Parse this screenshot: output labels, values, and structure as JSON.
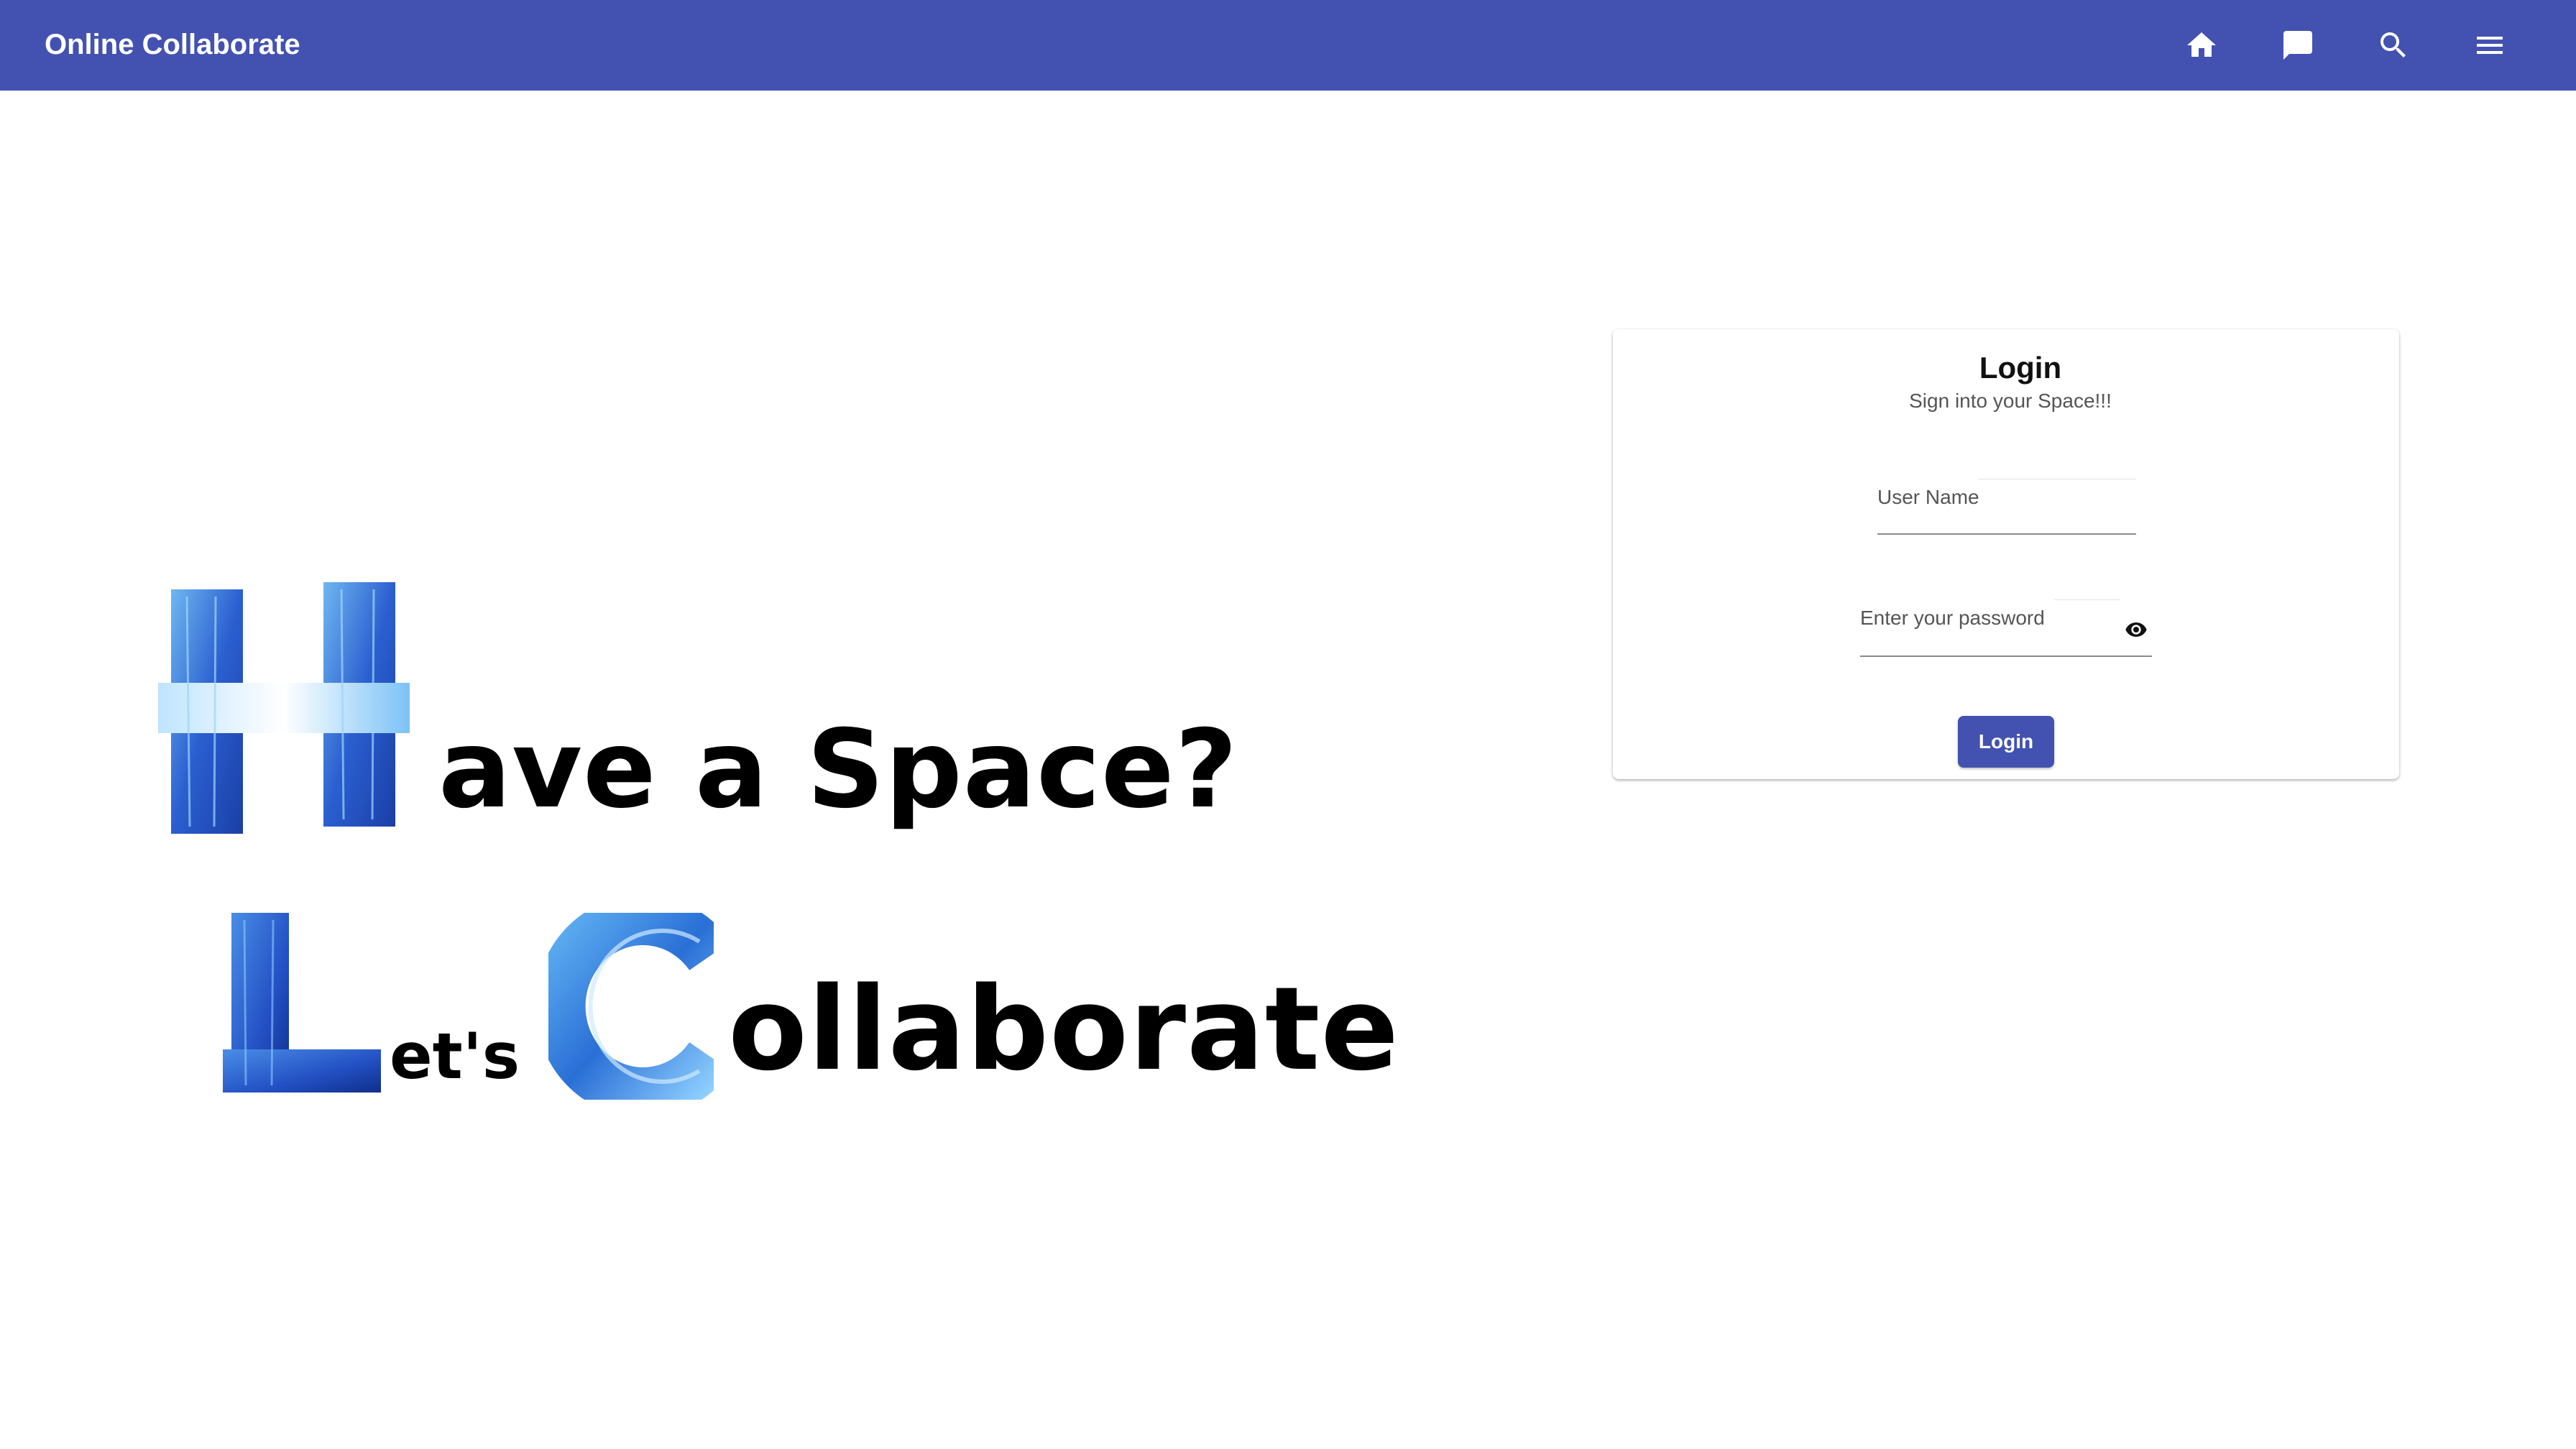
{
  "toolbar": {
    "title": "Online Collaborate",
    "background_color": "#4352b1",
    "nav_icons": [
      "home-icon",
      "chat-icon",
      "search-icon",
      "menu-icon"
    ]
  },
  "hero": {
    "line1_initial": "H",
    "line1_text": "ave a Space?",
    "line2_initial1": "L",
    "line2_text1": "et's",
    "line2_initial2": "C",
    "line2_text2": "ollaborate",
    "brush_color": "#2b5fd0"
  },
  "login": {
    "title": "Login",
    "subtitle": "Sign into your Space!!!",
    "username_label": "User Name",
    "username_value": "",
    "password_label": "Enter your password",
    "password_value": "",
    "visibility_icon": "eye-icon",
    "submit_label": "Login",
    "button_color": "#4352b1"
  }
}
